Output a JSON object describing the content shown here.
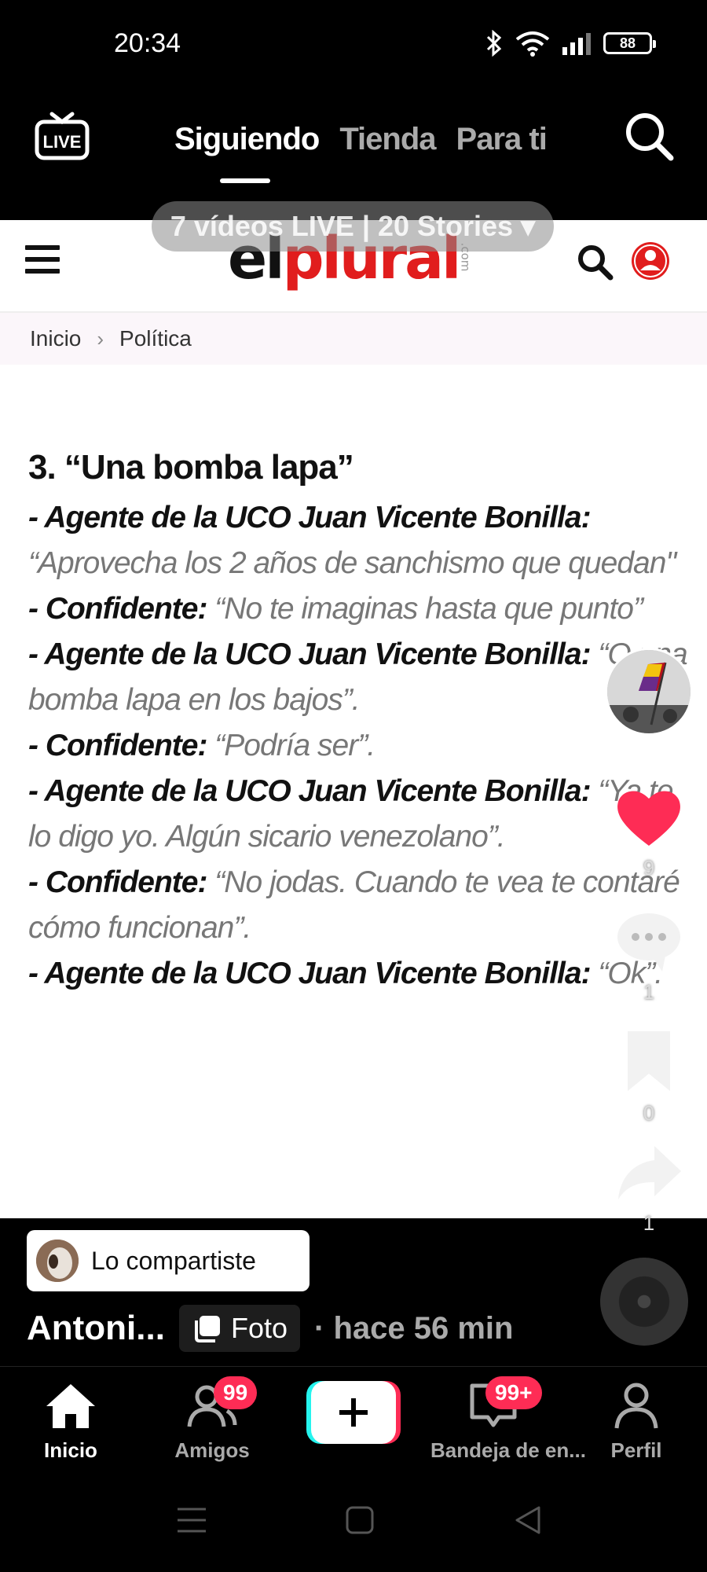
{
  "status_bar": {
    "time": "20:34",
    "battery": "88"
  },
  "top_nav": {
    "live_icon": "live-tv-icon",
    "tabs": [
      {
        "label": "Siguiendo",
        "active": true
      },
      {
        "label": "Tienda",
        "active": false
      },
      {
        "label": "Para ti",
        "active": false
      }
    ],
    "live_banner": "7 vídeos LIVE | 20 Stories ▾"
  },
  "site": {
    "logo_el": "el",
    "logo_plural": "plural",
    "logo_com": ".com",
    "breadcrumb": {
      "home": "Inicio",
      "section": "Política"
    }
  },
  "article": {
    "heading": "3. “Una bomba lapa”",
    "lines": [
      {
        "speaker": "- Agente de la UCO Juan Vicente Bonilla:",
        "quote": " “Aprovecha los 2 años de sanchismo que quedan\""
      },
      {
        "speaker": "- Confidente:",
        "quote": " “No te imaginas hasta que punto”"
      },
      {
        "speaker": "- Agente de la UCO Juan Vicente Bonilla:",
        "quote": " “O una bomba lapa en los bajos”."
      },
      {
        "speaker": "- Confidente:",
        "quote": " “Podría ser”."
      },
      {
        "speaker": "- Agente de la UCO Juan Vicente Bonilla:",
        "quote": " “Ya te lo digo yo. Algún sicario venezolano”."
      },
      {
        "speaker": "- Confidente:",
        "quote": " “No jodas. Cuando te vea te contaré cómo funcionan”."
      },
      {
        "speaker": "- Agente de la UCO Juan Vicente Bonilla:",
        "quote": "  “Ok”."
      }
    ]
  },
  "rail": {
    "likes": "9",
    "comments": "1",
    "saves": "0",
    "shares": "1",
    "like_color": "#fe2c55"
  },
  "post": {
    "shared_label": "Lo compartiste",
    "author": "Antoni...",
    "type_label": "Foto",
    "time_ago": "· hace 56 min"
  },
  "bottom_nav": {
    "home": "Inicio",
    "friends": "Amigos",
    "friends_badge": "99",
    "inbox": "Bandeja de en...",
    "inbox_badge": "99+",
    "profile": "Perfil"
  }
}
